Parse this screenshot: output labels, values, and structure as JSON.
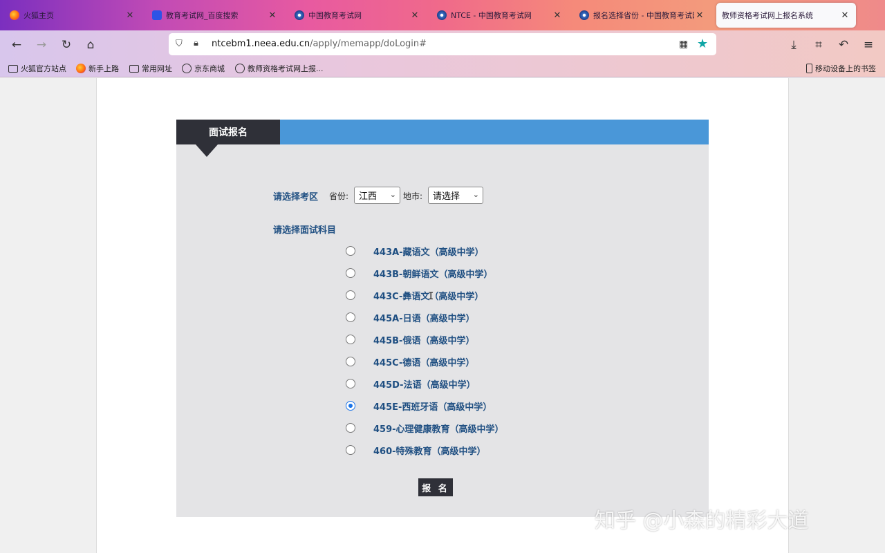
{
  "tabs": [
    {
      "title": "火狐主页",
      "icon": "firefox-icon"
    },
    {
      "title": "教育考试网_百度搜索",
      "icon": "baidu-icon"
    },
    {
      "title": "中国教育考试网",
      "icon": "neea-icon"
    },
    {
      "title": "NTCE - 中国教育考试网",
      "icon": "neea-icon"
    },
    {
      "title": "报名选择省份 - 中国教育考试网",
      "icon": "neea-icon"
    },
    {
      "title": "教师资格考试网上报名系统",
      "icon": "none"
    }
  ],
  "url": {
    "domain": "ntcebm1.neea.edu.cn",
    "path": "/apply/memapp/doLogin#"
  },
  "bookmarks": [
    {
      "label": "火狐官方站点",
      "icon": "folder-icon"
    },
    {
      "label": "新手上路",
      "icon": "firefox-icon"
    },
    {
      "label": "常用网址",
      "icon": "folder-icon"
    },
    {
      "label": "京东商城",
      "icon": "globe-icon"
    },
    {
      "label": "教师资格考试网上报...",
      "icon": "globe-icon"
    }
  ],
  "mobile_bookmarks": "移动设备上的书签",
  "panel": {
    "tab_title": "面试报名",
    "region_label": "请选择考区",
    "province_label": "省份:",
    "province_value": "江西",
    "city_label": "地市:",
    "city_value": "请选择",
    "subject_label": "请选择面试科目",
    "submit_label": "报 名"
  },
  "subjects": [
    {
      "label": "443A-藏语文（高级中学）",
      "selected": false
    },
    {
      "label": "443B-朝鲜语文（高级中学）",
      "selected": false
    },
    {
      "label": "443C-彝语文（高级中学）",
      "selected": false
    },
    {
      "label": "445A-日语（高级中学）",
      "selected": false
    },
    {
      "label": "445B-俄语（高级中学）",
      "selected": false
    },
    {
      "label": "445C-德语（高级中学）",
      "selected": false
    },
    {
      "label": "445D-法语（高级中学）",
      "selected": false
    },
    {
      "label": "445E-西班牙语（高级中学）",
      "selected": true
    },
    {
      "label": "459-心理健康教育（高级中学）",
      "selected": false
    },
    {
      "label": "460-特殊教育（高级中学）",
      "selected": false
    }
  ],
  "watermark": "知乎 @小森的精彩大道",
  "colors": {
    "accent_blue": "#4a97d8",
    "dark_tab": "#2f3038",
    "label_blue": "#1f4f82",
    "star_teal": "#0ea5a5"
  }
}
